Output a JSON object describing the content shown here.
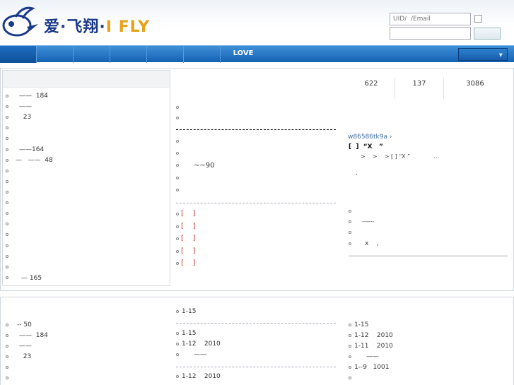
{
  "header": {
    "logo_cn": "爱·飞翔·",
    "logo_en": "I FLY",
    "login": {
      "uid_placeholder": "UID/  /Email",
      "password_placeholder": ""
    }
  },
  "nav": {
    "items": [
      "",
      "",
      "",
      "",
      "",
      ""
    ],
    "love_label": "LOVE",
    "select_arrow": "▼"
  },
  "stats": [
    "622",
    "137",
    "3086"
  ],
  "left_list": [
    "——  184",
    "——",
    "  23",
    "",
    "",
    "——164",
    "—   ——  48",
    "",
    "",
    "",
    "",
    "",
    "",
    "",
    "",
    "",
    "— 165"
  ],
  "middle_list_a": [
    "",
    ""
  ],
  "middle_list_b": [
    "",
    "",
    "~~90",
    "",
    ""
  ],
  "middle_list_red": [
    "[    ]",
    "[    ]",
    "[    ]",
    "[    ]",
    "[    ]"
  ],
  "story": {
    "user": "w86586tk9a ›",
    "title": "[  ]  “X   ”",
    "sub": ">    >    > [ ] “X ”             …",
    "mark": "’"
  },
  "right_list": [
    "",
    "------",
    "",
    "x    ,"
  ],
  "bottom": {
    "left_list": [
      "-- 50",
      "——  184",
      "——",
      "  23",
      "",
      ""
    ],
    "middle_list": [
      "1-15",
      "1-15",
      "1-12    2010",
      "——",
      "1-12    2010"
    ],
    "right_list": [
      "1-15",
      "1-12    2010",
      "1-11    2010",
      "——",
      "1--9   1001",
      ""
    ]
  }
}
